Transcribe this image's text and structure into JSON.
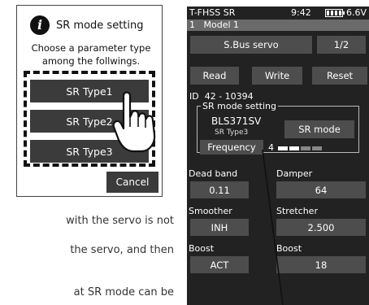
{
  "dialog": {
    "title": "SR mode setting",
    "info_icon_glyph": "i",
    "prompt": "Choose a parameter type among the follwings.",
    "options": [
      "SR Type1",
      "SR Type2",
      "SR Type3"
    ],
    "cancel_label": "Cancel"
  },
  "body_text": [
    "with the servo is not",
    "the servo, and then",
    "at SR mode can be"
  ],
  "device": {
    "app_name": "T-FHSS SR",
    "time": "9:42",
    "voltage": "6.6V",
    "model": "1   Model 1",
    "servo_type": "S.Bus servo",
    "page": "1/2",
    "read_label": "Read",
    "write_label": "Write",
    "reset_label": "Reset",
    "id": "ID  42 - 10394",
    "sr_section_label": "SR mode setting",
    "servo_model": "BLS371SV",
    "sr_type": "SR Type3",
    "sr_mode_label": "SR mode",
    "frequency_label": "Frequency",
    "frequency_value": "4",
    "params": [
      {
        "label": "Dead band",
        "value": "0.11"
      },
      {
        "label": "Damper",
        "value": "64"
      },
      {
        "label": "Smoother",
        "value": "INH"
      },
      {
        "label": "Stretcher",
        "value": "2.500"
      },
      {
        "label": "Boost",
        "value": "ACT"
      },
      {
        "label": "Boost",
        "value": "18"
      }
    ]
  },
  "colors": {
    "screen_bg": "#222222",
    "tile": "#4d4d4d",
    "button_dark": "#3b3b3b"
  },
  "icons": [
    "info-icon",
    "hand-pointer-icon",
    "battery-icon"
  ]
}
